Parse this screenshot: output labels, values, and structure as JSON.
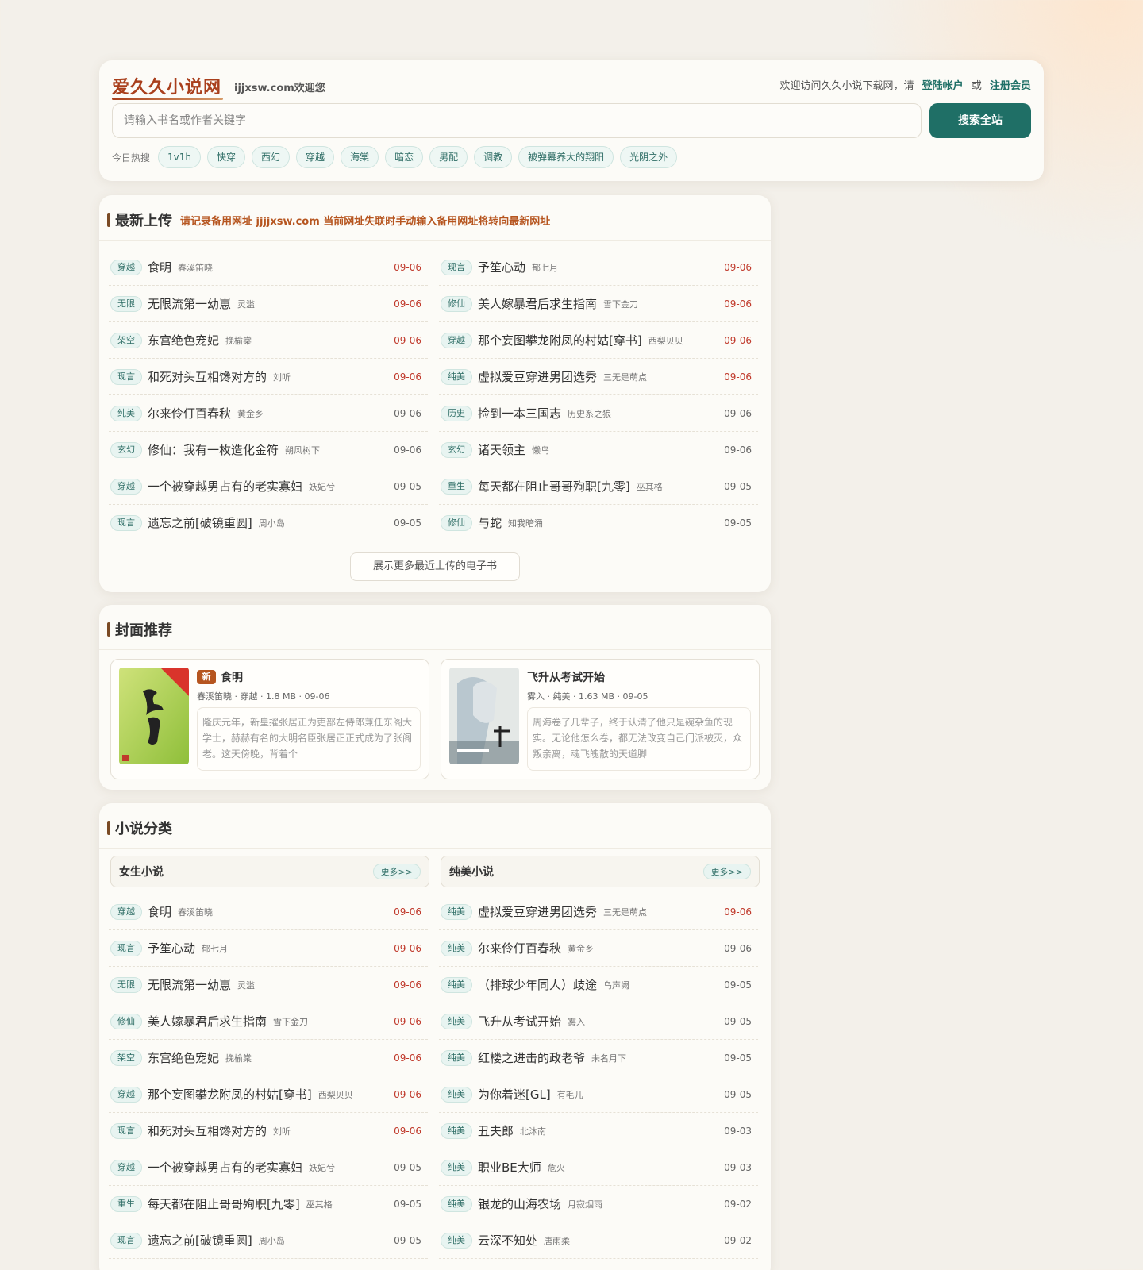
{
  "header": {
    "site_title": "爱久久小说网",
    "site_welcome": "ijjxsw.com欢迎您",
    "top_text": "欢迎访问久久小说下载网，请",
    "login_label": "登陆帐户",
    "or_text": "或",
    "register_label": "注册会员",
    "search_placeholder": "请输入书名或作者关键字",
    "search_button": "搜索全站",
    "hot_label": "今日热搜",
    "hot_tags": [
      "1v1h",
      "快穿",
      "西幻",
      "穿越",
      "海棠",
      "暗恋",
      "男配",
      "调教",
      "被弹幕养大的翔阳",
      "光阴之外"
    ]
  },
  "latest": {
    "title": "最新上传",
    "note": "请记录备用网址 jjjjxsw.com 当前网址失联时手动输入备用网址将转向最新网址",
    "more_button": "展示更多最近上传的电子书",
    "left": [
      {
        "tag": "穿越",
        "title": "食明",
        "author": "春溪笛晓",
        "date": "09-06",
        "hot": true
      },
      {
        "tag": "无限",
        "title": "无限流第一幼崽",
        "author": "灵滥",
        "date": "09-06",
        "hot": true
      },
      {
        "tag": "架空",
        "title": "东宫绝色宠妃",
        "author": "挽榆棠",
        "date": "09-06",
        "hot": true
      },
      {
        "tag": "现言",
        "title": "和死对头互相馋对方的",
        "author": "刘听",
        "date": "09-06",
        "hot": true
      },
      {
        "tag": "纯美",
        "title": "尔来伶仃百春秋",
        "author": "黄金乡",
        "date": "09-06",
        "hot": false
      },
      {
        "tag": "玄幻",
        "title": "修仙：我有一枚造化金符",
        "author": "朔风树下",
        "date": "09-06",
        "hot": false
      },
      {
        "tag": "穿越",
        "title": "一个被穿越男占有的老实寡妇",
        "author": "妖妃兮",
        "date": "09-05",
        "hot": false
      },
      {
        "tag": "现言",
        "title": "遗忘之前[破镜重圆]",
        "author": "周小岛",
        "date": "09-05",
        "hot": false
      }
    ],
    "right": [
      {
        "tag": "现言",
        "title": "予笙心动",
        "author": "郁七月",
        "date": "09-06",
        "hot": true
      },
      {
        "tag": "修仙",
        "title": "美人嫁暴君后求生指南",
        "author": "雪下金刀",
        "date": "09-06",
        "hot": true
      },
      {
        "tag": "穿越",
        "title": "那个妄图攀龙附凤的村姑[穿书]",
        "author": "西梨贝贝",
        "date": "09-06",
        "hot": true
      },
      {
        "tag": "纯美",
        "title": "虚拟爱豆穿进男团选秀",
        "author": "三无是萌点",
        "date": "09-06",
        "hot": true
      },
      {
        "tag": "历史",
        "title": "捡到一本三国志",
        "author": "历史系之狼",
        "date": "09-06",
        "hot": false
      },
      {
        "tag": "玄幻",
        "title": "诸天领主",
        "author": "懒鸟",
        "date": "09-06",
        "hot": false
      },
      {
        "tag": "重生",
        "title": "每天都在阻止哥哥殉职[九零]",
        "author": "巫其格",
        "date": "09-05",
        "hot": false
      },
      {
        "tag": "修仙",
        "title": "与蛇",
        "author": "知我暗涌",
        "date": "09-05",
        "hot": false
      }
    ]
  },
  "covers": {
    "title": "封面推荐",
    "items": [
      {
        "badge": "新",
        "title": "食明",
        "meta": "春溪笛晓 · 穿越 · 1.8 MB · 09-06",
        "desc": "隆庆元年，新皇擢张居正为吏部左侍郎兼任东阁大学士，赫赫有名的大明名臣张居正正式成为了张阁老。这天傍晚，背着个"
      },
      {
        "badge": "",
        "title": "飞升从考试开始",
        "meta": "雾入 · 纯美 · 1.63 MB · 09-05",
        "desc": "周海卷了几辈子，终于认清了他只是碗杂鱼的现实。无论他怎么卷，都无法改变自己门派被灭，众叛亲离，魂飞魄散的天道脚"
      }
    ]
  },
  "categories": {
    "title": "小说分类",
    "groups": [
      {
        "name": "女生小说",
        "more": "更多>>",
        "items": [
          {
            "tag": "穿越",
            "title": "食明",
            "author": "春溪笛晓",
            "date": "09-06",
            "hot": true
          },
          {
            "tag": "现言",
            "title": "予笙心动",
            "author": "郁七月",
            "date": "09-06",
            "hot": true
          },
          {
            "tag": "无限",
            "title": "无限流第一幼崽",
            "author": "灵滥",
            "date": "09-06",
            "hot": true
          },
          {
            "tag": "修仙",
            "title": "美人嫁暴君后求生指南",
            "author": "雪下金刀",
            "date": "09-06",
            "hot": true
          },
          {
            "tag": "架空",
            "title": "东宫绝色宠妃",
            "author": "挽榆棠",
            "date": "09-06",
            "hot": true
          },
          {
            "tag": "穿越",
            "title": "那个妄图攀龙附凤的村姑[穿书]",
            "author": "西梨贝贝",
            "date": "09-06",
            "hot": true
          },
          {
            "tag": "现言",
            "title": "和死对头互相馋对方的",
            "author": "刘听",
            "date": "09-06",
            "hot": true
          },
          {
            "tag": "穿越",
            "title": "一个被穿越男占有的老实寡妇",
            "author": "妖妃兮",
            "date": "09-05",
            "hot": false
          },
          {
            "tag": "重生",
            "title": "每天都在阻止哥哥殉职[九零]",
            "author": "巫其格",
            "date": "09-05",
            "hot": false
          },
          {
            "tag": "现言",
            "title": "遗忘之前[破镜重圆]",
            "author": "周小岛",
            "date": "09-05",
            "hot": false
          }
        ]
      },
      {
        "name": "纯美小说",
        "more": "更多>>",
        "items": [
          {
            "tag": "纯美",
            "title": "虚拟爱豆穿进男团选秀",
            "author": "三无是萌点",
            "date": "09-06",
            "hot": true
          },
          {
            "tag": "纯美",
            "title": "尔来伶仃百春秋",
            "author": "黄金乡",
            "date": "09-06",
            "hot": false
          },
          {
            "tag": "纯美",
            "title": "（排球少年同人）歧途",
            "author": "乌声阙",
            "date": "09-05",
            "hot": false
          },
          {
            "tag": "纯美",
            "title": "飞升从考试开始",
            "author": "雾入",
            "date": "09-05",
            "hot": false
          },
          {
            "tag": "纯美",
            "title": "红楼之进击的政老爷",
            "author": "未名月下",
            "date": "09-05",
            "hot": false
          },
          {
            "tag": "纯美",
            "title": "为你着迷[GL]",
            "author": "有毛儿",
            "date": "09-05",
            "hot": false
          },
          {
            "tag": "纯美",
            "title": "丑夫郎",
            "author": "北沐南",
            "date": "09-03",
            "hot": false
          },
          {
            "tag": "纯美",
            "title": "职业BE大师",
            "author": "危火",
            "date": "09-03",
            "hot": false
          },
          {
            "tag": "纯美",
            "title": "银龙的山海农场",
            "author": "月寂烟雨",
            "date": "09-02",
            "hot": false
          },
          {
            "tag": "纯美",
            "title": "云深不知处",
            "author": "唐雨柔",
            "date": "09-02",
            "hot": false
          }
        ]
      }
    ]
  }
}
